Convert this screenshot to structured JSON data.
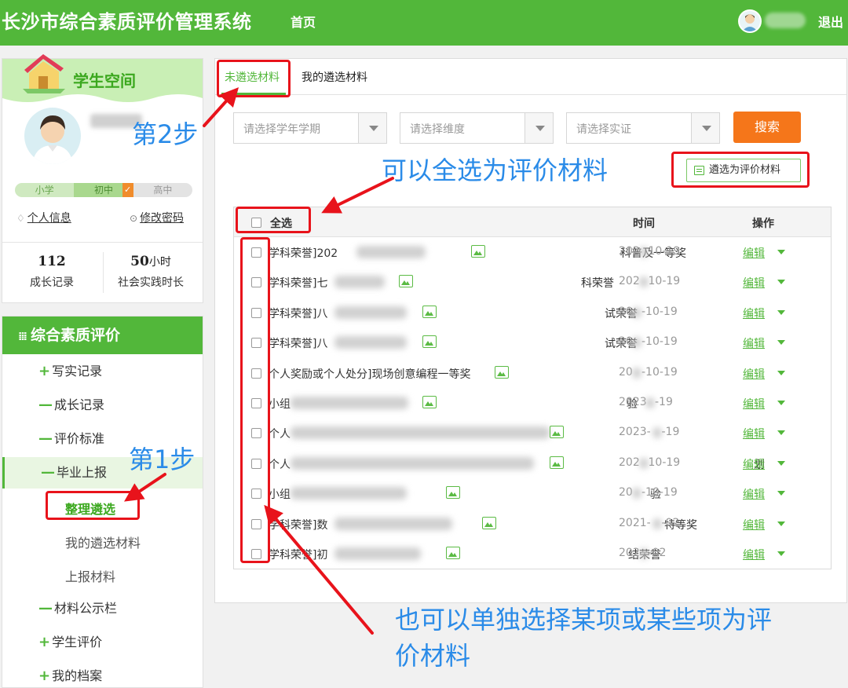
{
  "header": {
    "title": "长沙市综合素质评价管理系统",
    "home": "首页",
    "logout": "退出"
  },
  "student": {
    "space_title": "学生空间",
    "stages": [
      "小学",
      "初中",
      "高中"
    ],
    "personal_info": "个人信息",
    "change_password": "修改密码",
    "growth_count": "112",
    "growth_label": "成长记录",
    "practice_hours": "50",
    "practice_unit": "小时",
    "practice_label": "社会实践时长"
  },
  "nav": {
    "title": "综合素质评价",
    "items": [
      {
        "prefix": "+",
        "label": "写实记录"
      },
      {
        "prefix": "—",
        "label": "成长记录"
      },
      {
        "prefix": "—",
        "label": "评价标准"
      },
      {
        "prefix": "—",
        "label": "毕业上报"
      },
      {
        "prefix": "—",
        "label": "材料公示栏"
      },
      {
        "prefix": "+",
        "label": "学生评价"
      },
      {
        "prefix": "+",
        "label": "我的档案"
      }
    ],
    "sub_items": [
      "整理遴选",
      "我的遴选材料",
      "上报材料"
    ]
  },
  "main": {
    "tabs": [
      "未遴选材料",
      "我的遴选材料"
    ],
    "filters": {
      "term": "请选择学年学期",
      "dimension": "请选择维度",
      "evidence": "请选择实证"
    },
    "search_label": "搜索",
    "select_material_label": "遴选为评价材料",
    "table": {
      "select_all": "全选",
      "col_time": "时间",
      "col_op": "操作",
      "edit_label": "编辑",
      "rows": [
        {
          "name": "学科荣誉]202",
          "name2": "科普及一等奖",
          "date": "202",
          "date2": "10-19"
        },
        {
          "name": "学科荣誉]七",
          "name2": "科荣誉",
          "date": "202",
          "date2": "10-19"
        },
        {
          "name": "学科荣誉]八",
          "name2": "试荣誉",
          "date": "20",
          "date2": "-10-19"
        },
        {
          "name": "学科荣誉]八",
          "name2": "试荣誉",
          "date": "20",
          "date2": "-10-19"
        },
        {
          "name": "个人奖励或个人处分]现场创意编程一等奖",
          "name2": "",
          "date": "20",
          "date2": "-10-19"
        },
        {
          "name": "小组",
          "name2": "验",
          "date": "2023",
          "date2": "-19"
        },
        {
          "name": "个人",
          "name2": "",
          "date": "2023-",
          "date2": "-19"
        },
        {
          "name": "个人",
          "name2": "划",
          "date": "202",
          "date2": "10-19"
        },
        {
          "name": "小组",
          "name2": "验",
          "date": "20",
          "date2": "-10-19"
        },
        {
          "name": "学科荣誉]数",
          "name2": "特等奖",
          "date": "2021-",
          "date2": "-02"
        },
        {
          "name": "学科荣誉]初",
          "name2": "结荣誉",
          "date": "202",
          "date2": "-02"
        }
      ]
    }
  },
  "annotations": {
    "step1": "第1步",
    "step2": "第2步",
    "select_all_hint": "可以全选为评价材料",
    "single_hint_line1": "也可以单独选择某项或某些项为评",
    "single_hint_line2": "价材料"
  },
  "colors": {
    "brand_green": "#52b73a",
    "search_orange": "#f5761a",
    "annotation_red": "#e8131b",
    "annotation_blue": "#2a8be8"
  }
}
